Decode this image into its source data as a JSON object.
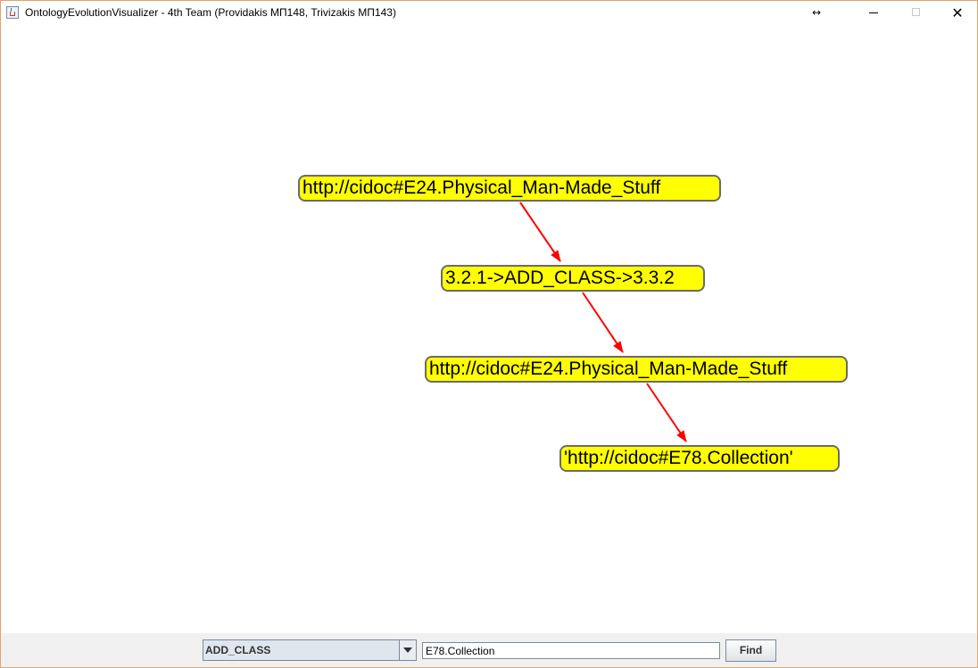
{
  "window": {
    "title": "OntologyEvolutionVisualizer - 4th Team (Providakis ΜΠ148, Trivizakis ΜΠ143)",
    "resize_glyph": "↔",
    "close_glyph": "✕"
  },
  "graph": {
    "nodes": [
      {
        "id": "n1",
        "label": "http://cidoc#E24.Physical_Man-Made_Stuff"
      },
      {
        "id": "n2",
        "label": "3.2.1->ADD_CLASS->3.3.2"
      },
      {
        "id": "n3",
        "label": "http://cidoc#E24.Physical_Man-Made_Stuff"
      },
      {
        "id": "n4",
        "label": "'http://cidoc#E78.Collection'"
      }
    ],
    "edges": [
      {
        "from": "n1",
        "to": "n2"
      },
      {
        "from": "n2",
        "to": "n3"
      },
      {
        "from": "n3",
        "to": "n4"
      }
    ],
    "colors": {
      "node_fill": "#ffff00",
      "node_border": "#6b6b6b",
      "edge": "#ff0000"
    }
  },
  "controls": {
    "change_type": "ADD_CLASS",
    "search_value": "E78.Collection",
    "find_label": "Find"
  }
}
